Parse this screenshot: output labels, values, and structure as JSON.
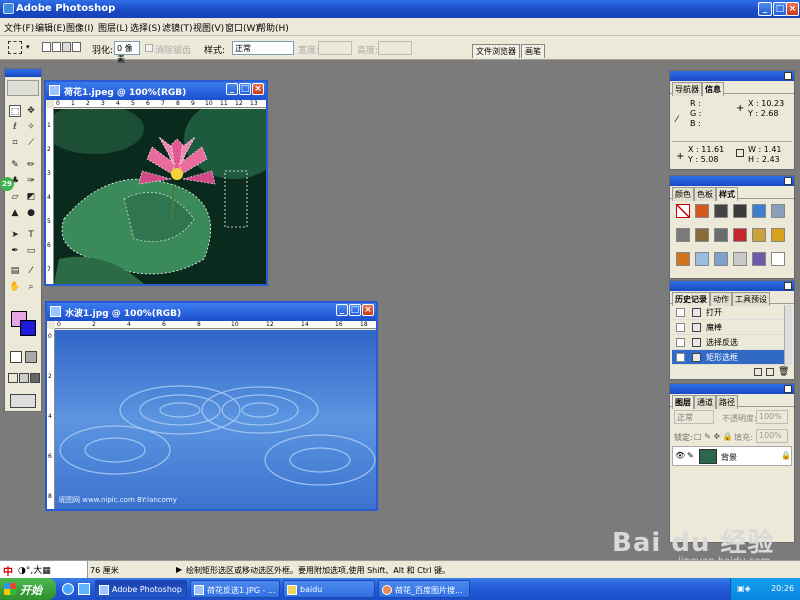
{
  "app": {
    "title": "Adobe Photoshop"
  },
  "menu": [
    "文件(F)",
    "编辑(E)",
    "图像(I)",
    "图层(L)",
    "选择(S)",
    "滤镜(T)",
    "视图(V)",
    "窗口(W)",
    "帮助(H)"
  ],
  "options": {
    "feather_label": "羽化:",
    "feather_value": "0 像素",
    "antialias_label": "消除锯齿",
    "style_label": "样式:",
    "style_value": "正常",
    "width_label": "宽度:",
    "height_label": "高度:",
    "dock_tabs": [
      "文件浏览器",
      "画笔"
    ]
  },
  "doc1": {
    "title": "荷花1.jpeg @ 100%(RGB)",
    "ruler_top": [
      "0",
      "1",
      "2",
      "3",
      "4",
      "5",
      "6",
      "7",
      "8",
      "9",
      "10",
      "11",
      "12",
      "13"
    ],
    "ruler_left": [
      "1",
      "2",
      "3",
      "4",
      "5",
      "6",
      "7"
    ]
  },
  "doc2": {
    "title": "水波1.jpg @ 100%(RGB)",
    "ruler_top": [
      "0",
      "2",
      "4",
      "6",
      "8",
      "10",
      "12",
      "14",
      "16",
      "18"
    ],
    "ruler_left": [
      "0",
      "2",
      "4",
      "6",
      "8"
    ],
    "watermark": "昵图网 www.nipic.com  BY:lancomy"
  },
  "toolbox": {
    "badge": "29"
  },
  "navigator": {
    "tabs": [
      "导航器",
      "信息"
    ],
    "r": "R :",
    "g": "G :",
    "b": "B :",
    "x": "X :",
    "x_val": "10.23",
    "y": "Y :",
    "y_val": "2.68",
    "x2": "X :",
    "x2_val": "11.61",
    "y2": "Y :",
    "y2_val": "5.08",
    "w": "W :",
    "w_val": "1.41",
    "h": "H :",
    "h_val": "2.43"
  },
  "styles": {
    "tabs": [
      "颜色",
      "色板",
      "样式"
    ]
  },
  "history": {
    "tabs": [
      "历史记录",
      "动作",
      "工具预设"
    ],
    "items": [
      {
        "label": "打开"
      },
      {
        "label": "魔棒"
      },
      {
        "label": "选择反选"
      },
      {
        "label": "矩形选框"
      }
    ]
  },
  "layers": {
    "tabs": [
      "图层",
      "通道",
      "路径"
    ],
    "blend": "正常",
    "opacity_label": "不透明度:",
    "opacity": "100%",
    "lock_label": "锁定:",
    "fill_label": "填充:",
    "fill": "100%",
    "layer_name": "背景"
  },
  "status": {
    "zoom": "76 厘米",
    "hint": "绘制矩形选区或移动选区外框。要用附加选项,使用 Shift、Alt 和 Ctrl 键。",
    "ime": "中"
  },
  "taskbar": {
    "start": "开始",
    "tasks": [
      "Adobe Photoshop",
      "荷花反选1.JPG - ...",
      "baidu",
      "荷花_百度图片搜..."
    ],
    "clock": "20:26"
  },
  "watermark": {
    "brand": "Bai du 经验",
    "url": "jingyan.baidu.com"
  }
}
